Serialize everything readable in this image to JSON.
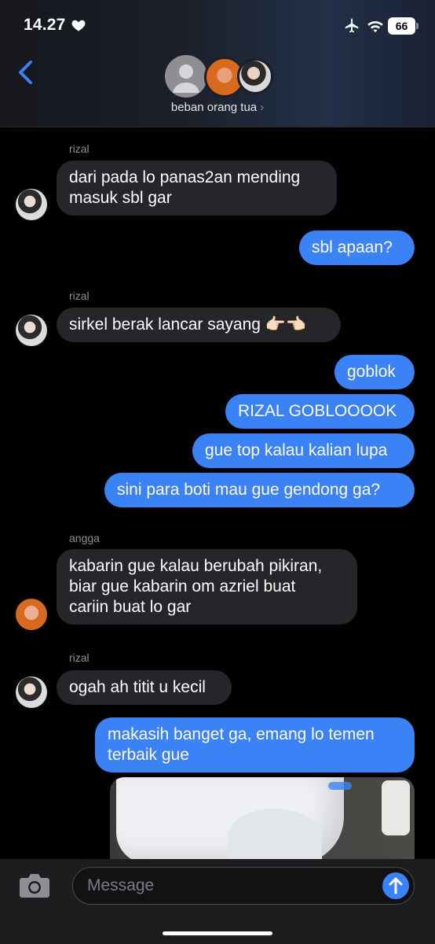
{
  "status": {
    "time": "14.27",
    "battery": "66"
  },
  "header": {
    "group_name": "beban orang tua",
    "chevron": "›"
  },
  "messages": [
    {
      "type": "sender",
      "text": "rizal"
    },
    {
      "type": "in",
      "sender": "rizal",
      "lines": [
        "dari pada lo panas2an mending",
        "masuk sbl gar"
      ]
    },
    {
      "type": "out",
      "lines": [
        "sbl apaan?"
      ]
    },
    {
      "type": "sender",
      "text": "rizal"
    },
    {
      "type": "in",
      "sender": "rizal",
      "lines": [
        "sirkel berak lancar sayang 👉🏻👈🏻"
      ]
    },
    {
      "type": "out",
      "lines": [
        "goblok"
      ]
    },
    {
      "type": "out",
      "lines": [
        "RIZAL GOBLOOOOK"
      ]
    },
    {
      "type": "out",
      "lines": [
        "gue top kalau kalian lupa"
      ]
    },
    {
      "type": "out",
      "lines": [
        "sini para boti mau gue gendong ga?"
      ]
    },
    {
      "type": "sender",
      "text": "angga"
    },
    {
      "type": "in",
      "sender": "angga",
      "lines": [
        "kabarin gue kalau berubah pikiran,",
        "biar gue kabarin om azriel buat",
        "cariin buat lo gar"
      ]
    },
    {
      "type": "sender",
      "text": "rizal"
    },
    {
      "type": "in",
      "sender": "rizal",
      "lines": [
        "ogah ah titit u kecil"
      ]
    },
    {
      "type": "out",
      "lines": [
        "makasih banget ga, emang lo temen",
        "terbaik gue"
      ]
    }
  ],
  "input": {
    "placeholder": "Message"
  },
  "colors": {
    "outgoing_bubble": "#3b82f6",
    "incoming_bubble": "#26252a",
    "accent": "#3b82f6"
  },
  "icons": [
    "heart-icon",
    "airplane-icon",
    "wifi-icon",
    "battery-icon",
    "chevron-left-icon",
    "camera-icon",
    "arrow-up-icon"
  ]
}
